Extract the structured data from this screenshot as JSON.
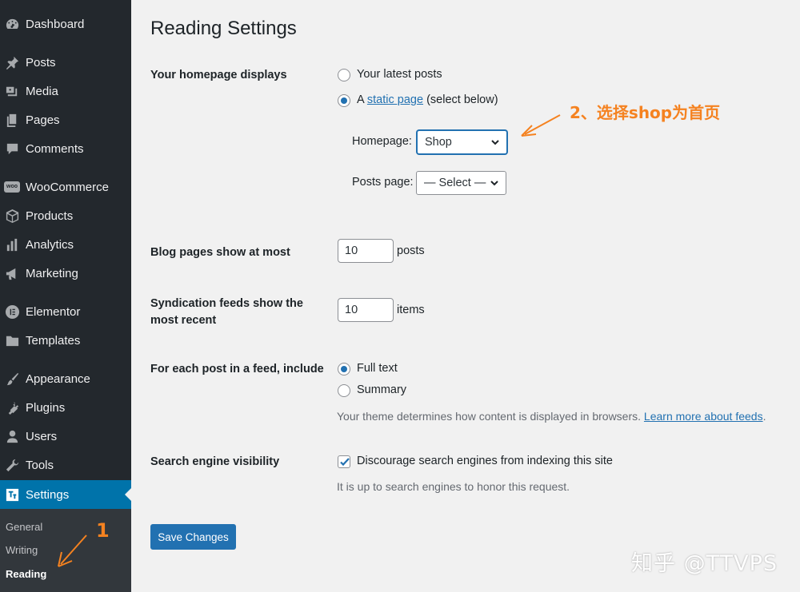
{
  "sidebar": {
    "items": [
      {
        "label": "Dashboard",
        "icon": "dashboard-icon"
      },
      {
        "label": "Posts",
        "icon": "pin-icon"
      },
      {
        "label": "Media",
        "icon": "media-icon"
      },
      {
        "label": "Pages",
        "icon": "pages-icon"
      },
      {
        "label": "Comments",
        "icon": "comment-icon"
      },
      {
        "label": "WooCommerce",
        "icon": "woocommerce-icon"
      },
      {
        "label": "Products",
        "icon": "box-icon"
      },
      {
        "label": "Analytics",
        "icon": "bar-chart-icon"
      },
      {
        "label": "Marketing",
        "icon": "megaphone-icon"
      },
      {
        "label": "Elementor",
        "icon": "elementor-icon"
      },
      {
        "label": "Templates",
        "icon": "folder-icon"
      },
      {
        "label": "Appearance",
        "icon": "brush-icon"
      },
      {
        "label": "Plugins",
        "icon": "plug-icon"
      },
      {
        "label": "Users",
        "icon": "user-icon"
      },
      {
        "label": "Tools",
        "icon": "wrench-icon"
      },
      {
        "label": "Settings",
        "icon": "settings-icon"
      }
    ],
    "active": "Settings",
    "woo_badge": "woo",
    "submenu": [
      "General",
      "Writing",
      "Reading"
    ],
    "current_sub": "Reading",
    "accent": "#0073aa",
    "bg": "#23282d"
  },
  "page": {
    "title": "Reading Settings"
  },
  "homepage": {
    "label": "Your homepage displays",
    "option_latest": "Your latest posts",
    "option_static_prefix": "A",
    "option_static_link": "static page",
    "option_static_suffix": "(select below)",
    "selected": "static",
    "homepage_label": "Homepage:",
    "homepage_value": "Shop",
    "posts_page_label": "Posts page:",
    "posts_page_value": "— Select —"
  },
  "blog_pages": {
    "label": "Blog pages show at most",
    "value": "10",
    "unit": "posts"
  },
  "syndication": {
    "label": "Syndication feeds show the most recent",
    "value": "10",
    "unit": "items"
  },
  "feed_include": {
    "label": "For each post in a feed, include",
    "option_full": "Full text",
    "option_summary": "Summary",
    "selected": "full",
    "desc": "Your theme determines how content is displayed in browsers.",
    "desc_link": "Learn more about feeds",
    "desc_end": "."
  },
  "visibility": {
    "label": "Search engine visibility",
    "checkbox_label": "Discourage search engines from indexing this site",
    "checked": true,
    "desc": "It is up to search engines to honor this request."
  },
  "save_label": "Save Changes",
  "annotations": {
    "step1": "1",
    "step2": "2、选择shop为首页",
    "color": "#f58220"
  },
  "watermark": "知乎 @TTVPS"
}
